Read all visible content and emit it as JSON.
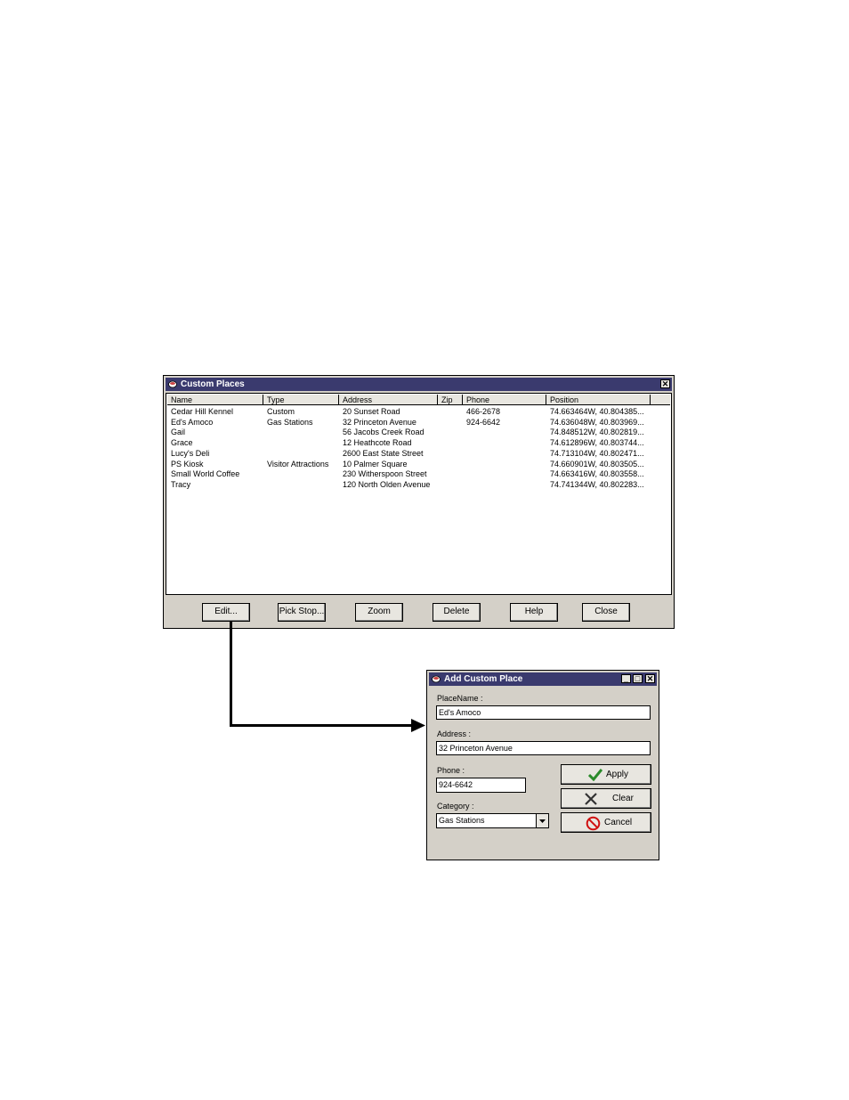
{
  "custom_places": {
    "title": "Custom Places",
    "close_glyph": "✕",
    "columns": [
      "Name",
      "Type",
      "Address",
      "Zip",
      "Phone",
      "Position"
    ],
    "rows": [
      [
        "Cedar Hill Kennel",
        "Custom",
        "20 Sunset Road",
        "",
        "466-2678",
        "74.663464W, 40.804385..."
      ],
      [
        "Ed's Amoco",
        "Gas Stations",
        "32 Princeton Avenue",
        "",
        "924-6642",
        "74.636048W, 40.803969..."
      ],
      [
        "Gail",
        "",
        "56 Jacobs Creek Road",
        "",
        "",
        "74.848512W, 40.802819..."
      ],
      [
        "Grace",
        "",
        "12 Heathcote Road",
        "",
        "",
        "74.612896W, 40.803744..."
      ],
      [
        "Lucy's Deli",
        "",
        "2600 East State Street",
        "",
        "",
        "74.713104W, 40.802471..."
      ],
      [
        "PS Kiosk",
        "Visitor Attractions",
        "10 Palmer Square",
        "",
        "",
        "74.660901W, 40.803505..."
      ],
      [
        "Small World Coffee",
        "",
        "230 Witherspoon Street",
        "",
        "",
        "74.663416W, 40.803558..."
      ],
      [
        "Tracy",
        "",
        "120 North Olden Avenue",
        "",
        "",
        "74.741344W, 40.802283..."
      ]
    ],
    "buttons": [
      "Edit...",
      "Pick Stop...",
      "Zoom",
      "Delete",
      "Help",
      "Close"
    ]
  },
  "add_place": {
    "title": "Add Custom Place",
    "minimize_glyph": "_",
    "maximize_glyph": "□",
    "close_glyph": "✕",
    "place_name_label": "PlaceName :",
    "place_name_value": "Ed's Amoco",
    "address_label": "Address :",
    "address_value": "32 Princeton Avenue",
    "phone_label": "Phone :",
    "phone_value": "924-6642",
    "category_label": "Category :",
    "category_value": "Gas Stations",
    "apply_label": "Apply",
    "clear_label": "Clear",
    "cancel_label": "Cancel",
    "colors": {
      "apply_check": "#2a8a2a",
      "cancel_red": "#d01010",
      "titlebar": "#3a3a6e"
    }
  }
}
